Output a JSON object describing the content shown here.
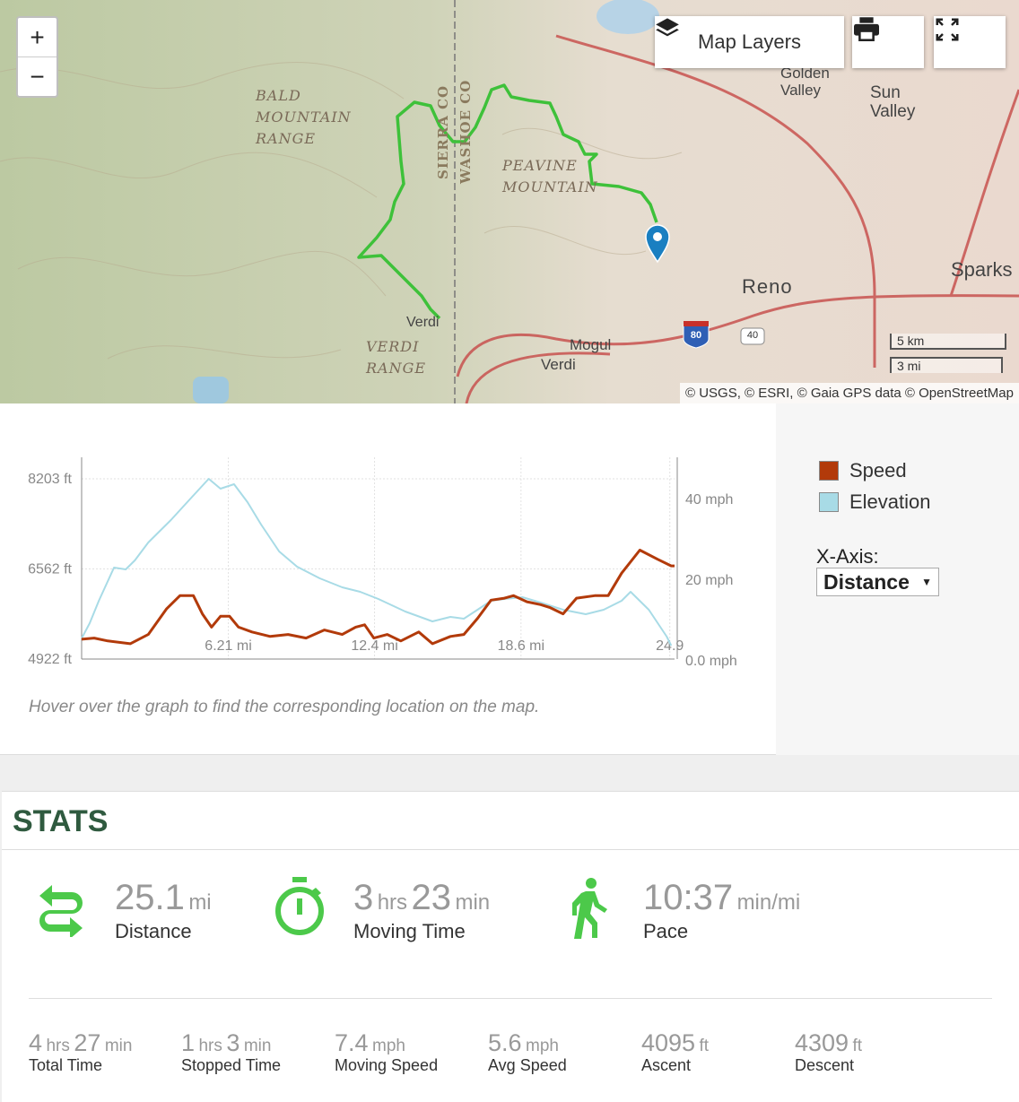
{
  "map": {
    "zoom_in": "+",
    "zoom_out": "−",
    "layers_button": "Map Layers",
    "layers_icon": "layers-icon",
    "print_icon": "printer-icon",
    "fullscreen_icon": "fullscreen-icon",
    "attribution": "© USGS, © ESRI, © Gaia GPS data © OpenStreetMap",
    "scale_km": "5 km",
    "scale_mi": "3 mi",
    "labels": {
      "bald": "BALD\nMOUNTAIN\nRANGE",
      "peavine": "PEAVINE\nMOUNTAIN",
      "verdi_range": "VERDI\nRANGE",
      "sierra": "SIERRA CO",
      "washoe": "WASHOE CO"
    },
    "cities": {
      "reno": "Reno",
      "sparks": "Sparks",
      "golden": "Golden\nValley",
      "sun": "Sun\nValley",
      "mogul": "Mogul",
      "verdi1": "Verdi",
      "verdi2": "Verdi"
    },
    "shields": {
      "i80": "80",
      "us40": "40"
    },
    "track_color": "#3ec13a",
    "marker_color": "#1a7fc1"
  },
  "chart": {
    "legend": [
      {
        "label": "Speed",
        "color": "#b23a0a"
      },
      {
        "label": "Elevation",
        "color": "#a8dbe6"
      }
    ],
    "xaxis_label": "X-Axis:",
    "xaxis_value": "Distance",
    "hint": "Hover over the graph to find the corresponding location on the map."
  },
  "chart_data": {
    "type": "line",
    "xlim": [
      0,
      25.1
    ],
    "x_ticks": [
      "6.21 mi",
      "12.4 mi",
      "18.6 mi",
      "24.9"
    ],
    "x_tick_values": [
      6.21,
      12.4,
      18.6,
      24.9
    ],
    "y_left": {
      "ticks": [
        "4922 ft",
        "6562 ft",
        "8203 ft"
      ],
      "tick_values": [
        4922,
        6562,
        8203
      ],
      "ylim": [
        4922,
        8594
      ]
    },
    "y_right": {
      "ticks": [
        "0.0 mph",
        "20 mph",
        "40 mph"
      ],
      "tick_values": [
        0,
        20,
        40
      ],
      "ylim": [
        0,
        50
      ]
    },
    "grid": true,
    "series": [
      {
        "name": "Elevation",
        "axis": "left",
        "color": "#a8dbe6",
        "x": [
          0,
          0.34,
          0.73,
          1.37,
          1.87,
          2.25,
          2.82,
          3.78,
          4.54,
          5.38,
          5.88,
          6.45,
          7.02,
          7.6,
          8.36,
          9.12,
          10.08,
          11.03,
          11.79,
          12.56,
          13.7,
          14.85,
          15.61,
          16.18,
          16.76,
          17.33,
          17.9,
          18.66,
          19.43,
          20.38,
          21.34,
          22.1,
          22.86,
          23.24,
          24.01,
          24.77,
          24.96
        ],
        "values": [
          5297,
          5575,
          5983,
          6587,
          6554,
          6717,
          7044,
          7452,
          7811,
          8203,
          8023,
          8104,
          7778,
          7370,
          6880,
          6603,
          6391,
          6228,
          6146,
          6015,
          5787,
          5607,
          5689,
          5656,
          5820,
          5983,
          6015,
          6048,
          5950,
          5820,
          5738,
          5820,
          5983,
          6146,
          5820,
          5330,
          5167
        ]
      },
      {
        "name": "Speed",
        "axis": "right",
        "color": "#b23a0a",
        "x": [
          0,
          0.53,
          1.11,
          2.06,
          2.82,
          3.59,
          4.16,
          4.73,
          5.11,
          5.5,
          5.88,
          6.26,
          6.64,
          7.21,
          7.98,
          8.74,
          9.5,
          10.27,
          11.03,
          11.6,
          11.98,
          12.37,
          12.94,
          13.51,
          14.27,
          14.85,
          15.61,
          16.18,
          16.76,
          17.33,
          17.9,
          18.28,
          18.85,
          19.43,
          19.81,
          20.38,
          20.95,
          21.72,
          22.29,
          22.86,
          23.63,
          24.39,
          24.96,
          25.1
        ],
        "values": [
          4.9,
          5.2,
          4.5,
          3.8,
          6.1,
          12.4,
          15.7,
          15.7,
          11.2,
          7.9,
          10.6,
          10.6,
          7.9,
          6.7,
          5.6,
          6.1,
          5.2,
          7.2,
          6.1,
          7.9,
          8.5,
          5.2,
          6.1,
          4.5,
          6.7,
          3.8,
          5.6,
          6.1,
          10.1,
          14.6,
          15.1,
          15.7,
          14.2,
          13.5,
          12.8,
          11.2,
          15.1,
          15.7,
          15.7,
          21.3,
          27.0,
          24.7,
          23.1,
          23.1
        ]
      }
    ]
  },
  "stats": {
    "title": "STATS",
    "main": [
      {
        "icon": "swap-arrows-icon",
        "parts": [
          [
            "25.1",
            "mi"
          ]
        ],
        "label": "Distance"
      },
      {
        "icon": "stopwatch-icon",
        "parts": [
          [
            "3",
            "hrs"
          ],
          [
            "23",
            "min"
          ]
        ],
        "label": "Moving Time"
      },
      {
        "icon": "walking-person-icon",
        "parts": [
          [
            "10:37",
            "min/mi"
          ]
        ],
        "label": "Pace"
      }
    ],
    "secondary": [
      {
        "parts": [
          [
            "4",
            "hrs"
          ],
          [
            "27",
            "min"
          ]
        ],
        "label": "Total Time"
      },
      {
        "parts": [
          [
            "1",
            "hrs"
          ],
          [
            "3",
            "min"
          ]
        ],
        "label": "Stopped Time"
      },
      {
        "parts": [
          [
            "7.4",
            "mph"
          ]
        ],
        "label": "Moving Speed"
      },
      {
        "parts": [
          [
            "5.6",
            "mph"
          ]
        ],
        "label": "Avg Speed"
      },
      {
        "parts": [
          [
            "4095",
            "ft"
          ]
        ],
        "label": "Ascent"
      },
      {
        "parts": [
          [
            "4309",
            "ft"
          ]
        ],
        "label": "Descent"
      }
    ],
    "icon_color": "#4cc94a"
  }
}
